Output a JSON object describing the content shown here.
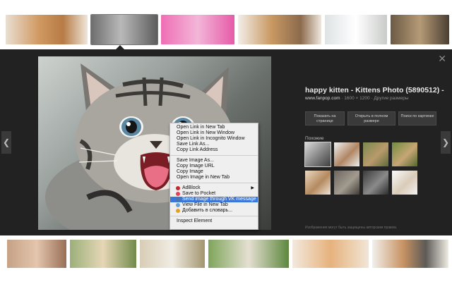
{
  "viewer": {
    "title": "happy kitten - Kittens Photo (5890512) - ...",
    "site": "www.fanpop.com",
    "meta": " · 1600 × 1200 · Другие размеры",
    "buttons": [
      "Показать на странице",
      "Открыть в полном размере",
      "Поиск по картинке"
    ],
    "similar_label": "Похожие",
    "copyright": "Изображения могут быть защищены авторским правом.",
    "close_glyph": "✕",
    "prev_glyph": "❮",
    "next_glyph": "❯"
  },
  "context_menu": {
    "items": [
      {
        "label": "Open Link in New Tab"
      },
      {
        "label": "Open Link in New Window"
      },
      {
        "label": "Open Link in Incognito Window"
      },
      {
        "label": "Save Link As..."
      },
      {
        "label": "Copy Link Address"
      },
      {
        "separator": true
      },
      {
        "label": "Save Image As..."
      },
      {
        "label": "Copy Image URL"
      },
      {
        "label": "Copy Image"
      },
      {
        "label": "Open Image in New Tab"
      },
      {
        "separator": true
      },
      {
        "label": "AdBlock",
        "icon": "adblock-icon",
        "icon_color": "#c8262b",
        "submenu": true
      },
      {
        "label": "Save to Pocket",
        "icon": "pocket-icon",
        "icon_color": "#e2405a"
      },
      {
        "label": "Send image through VK message",
        "icon": "vk-icon",
        "icon_color": "#4a76a8",
        "highlighted": true
      },
      {
        "label": "View File in New Tab",
        "icon": "file-icon",
        "icon_color": "#6a9fd8"
      },
      {
        "label": "Добавить в словарь...",
        "icon": "dictionary-icon",
        "icon_color": "#e5a02a"
      },
      {
        "separator": true
      },
      {
        "label": "Inspect Element"
      }
    ]
  },
  "colors": {
    "viewer_bg": "#222222",
    "menu_highlight": "#3b77d8",
    "link": "#d8d8d8"
  }
}
